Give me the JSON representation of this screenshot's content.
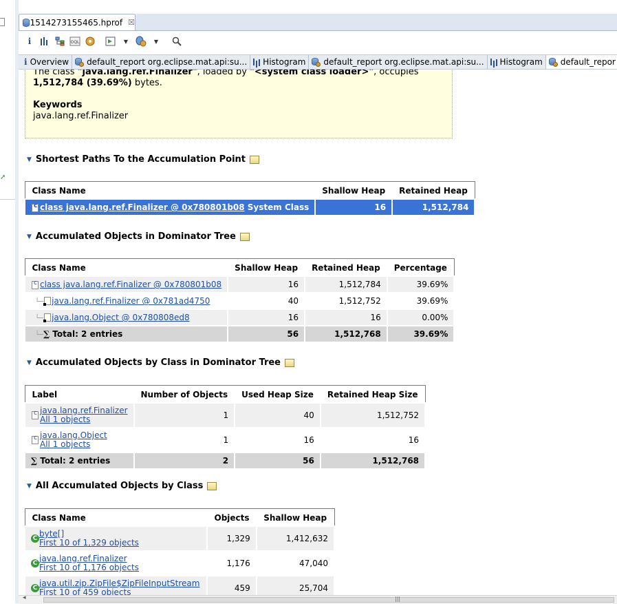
{
  "editor": {
    "tab_title": "1514273155465.hprof",
    "close_glyph": "☒"
  },
  "toolbar": {
    "icons": [
      "info-icon",
      "histogram-icon",
      "dominator-tree-icon",
      "oql-icon",
      "query-icon",
      "run-report-icon",
      "dropdown-icon",
      "heap-dump-icon",
      "dropdown-icon",
      "search-icon"
    ],
    "oql_label": "OQL"
  },
  "subtabs": [
    {
      "label": "Overview",
      "icon": "info-icon"
    },
    {
      "label": "default_report  org.eclipse.mat.api:su...",
      "icon": "report-icon"
    },
    {
      "label": "Histogram",
      "icon": "histogram-icon"
    },
    {
      "label": "default_report  org.eclipse.mat.api:su...",
      "icon": "report-icon"
    },
    {
      "label": "Histogram",
      "icon": "histogram-icon"
    },
    {
      "label": "default_repor",
      "icon": "report-icon"
    }
  ],
  "info": {
    "line1_prefix": "The class ",
    "line1_class": "\"java.lang.ref.Finalizer\"",
    "line1_mid": ", loaded by ",
    "line1_loader": "\"<system class loader>\"",
    "line1_suffix": ", occupies",
    "line2_bold": "1,512,784 (39.69%)",
    "line2_suffix": " bytes.",
    "keywords_title": "Keywords",
    "keywords_value": "java.lang.ref.Finalizer"
  },
  "sections": {
    "shortest_paths": {
      "title": "Shortest Paths To the Accumulation Point",
      "headers": [
        "Class Name",
        "Shallow Heap",
        "Retained Heap"
      ],
      "rows": [
        {
          "name": "class java.lang.ref.Finalizer @ 0x780801b08",
          "suffix": " System Class",
          "shallow": "16",
          "retained": "1,512,784"
        }
      ]
    },
    "dominator_tree": {
      "title": "Accumulated Objects in Dominator Tree",
      "headers": [
        "Class Name",
        "Shallow Heap",
        "Retained Heap",
        "Percentage"
      ],
      "rows": [
        {
          "name": "class java.lang.ref.Finalizer @ 0x780801b08",
          "shallow": "16",
          "retained": "1,512,784",
          "pct": "39.69%"
        },
        {
          "name": "java.lang.ref.Finalizer @ 0x781ad4750",
          "shallow": "40",
          "retained": "1,512,752",
          "pct": "39.69%"
        },
        {
          "name": "java.lang.Object @ 0x780808ed8",
          "shallow": "16",
          "retained": "16",
          "pct": "0.00%"
        }
      ],
      "total": {
        "label": "Total: 2 entries",
        "shallow": "56",
        "retained": "1,512,768",
        "pct": "39.69%"
      }
    },
    "by_class_dominator": {
      "title": "Accumulated Objects by Class in Dominator Tree",
      "headers": [
        "Label",
        "Number of Objects",
        "Used Heap Size",
        "Retained Heap Size"
      ],
      "rows": [
        {
          "name": "java.lang.ref.Finalizer",
          "sub": "All 1 objects",
          "count": "1",
          "used": "40",
          "retained": "1,512,752"
        },
        {
          "name": "java.lang.Object",
          "sub": "All 1 objects",
          "count": "1",
          "used": "16",
          "retained": "16"
        }
      ],
      "total": {
        "label": "Total: 2 entries",
        "count": "2",
        "used": "56",
        "retained": "1,512,768"
      }
    },
    "all_by_class": {
      "title": "All Accumulated Objects by Class",
      "headers": [
        "Class Name",
        "Objects",
        "Shallow Heap"
      ],
      "rows": [
        {
          "name": "byte[]",
          "sub": "First 10 of 1,329 objects",
          "objects": "1,329",
          "shallow": "1,412,632"
        },
        {
          "name": "java.lang.ref.Finalizer",
          "sub": "First 10 of 1,176 objects",
          "objects": "1,176",
          "shallow": "47,040"
        },
        {
          "name": "java.util.zip.ZipFile$ZipFileInputStream",
          "sub": "First 10 of 459 objects",
          "objects": "459",
          "shallow": "25,704"
        }
      ]
    }
  },
  "scrollbar": {
    "left_glyph": "◂",
    "grip": "|||"
  }
}
